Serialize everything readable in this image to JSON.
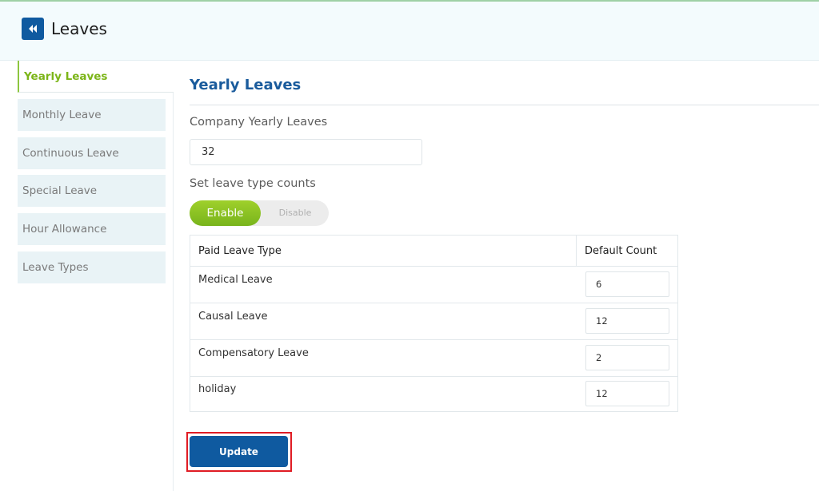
{
  "header": {
    "title": "Leaves",
    "back_icon": "double-chevron-left-icon"
  },
  "sidebar": {
    "items": [
      {
        "label": "Yearly Leaves",
        "active": true
      },
      {
        "label": "Monthly Leave",
        "active": false
      },
      {
        "label": "Continuous Leave",
        "active": false
      },
      {
        "label": "Special Leave",
        "active": false
      },
      {
        "label": "Hour Allowance",
        "active": false
      },
      {
        "label": "Leave Types",
        "active": false
      }
    ]
  },
  "main": {
    "section_title": "Yearly Leaves",
    "company_yearly_label": "Company Yearly Leaves",
    "company_yearly_value": "32",
    "leave_type_counts_label": "Set leave type counts",
    "toggle": {
      "enable_label": "Enable",
      "disable_label": "Disable",
      "selected": "Enable"
    },
    "table": {
      "headers": [
        "Paid Leave Type",
        "Default Count"
      ],
      "rows": [
        {
          "type": "Medical Leave",
          "count": "6"
        },
        {
          "type": "Causal Leave",
          "count": "12"
        },
        {
          "type": "Compensatory Leave",
          "count": "2"
        },
        {
          "type": "holiday",
          "count": "12"
        }
      ]
    },
    "update_label": "Update"
  },
  "colors": {
    "primary": "#0f5aa0",
    "accent_green": "#8cc63f",
    "highlight_red": "#e01c24"
  }
}
